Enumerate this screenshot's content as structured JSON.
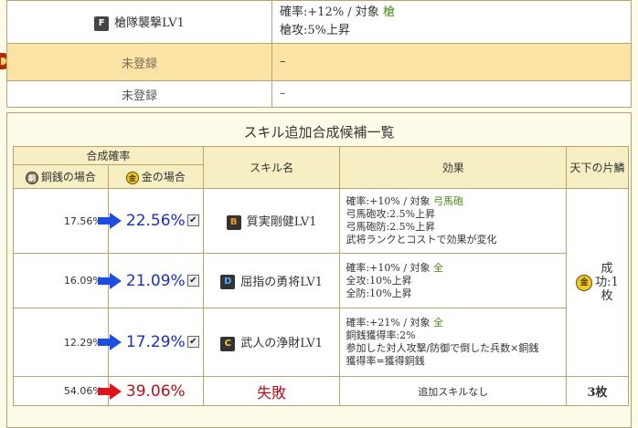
{
  "top_skills": [
    {
      "grade": "F",
      "name": "槍隊襲撃LV1",
      "effect_line1": "確率:+12% / 対象",
      "target": "槍",
      "effect_line2": "槍攻:5%上昇"
    },
    {
      "name": "未登録",
      "effect": "–"
    },
    {
      "name": "未登録",
      "effect": "–"
    }
  ],
  "section": {
    "title": "スキル追加合成候補一覧",
    "headers": {
      "rate": "合成確率",
      "copper": "銅銭の場合",
      "gold": "金の場合",
      "skill": "スキル名",
      "effect": "効果",
      "tenka": "天下の片鱗"
    },
    "coins": {
      "copper": "銅",
      "gold": "金"
    },
    "rows": [
      {
        "copper": "17.56%",
        "gold": "22.56%",
        "checked": "✔",
        "grade": "B",
        "skill": "質実剛健LV1",
        "eff": [
          "確率:+10% / 対象 ",
          "弓馬砲攻:2.5%上昇",
          "弓馬砲防:2.5%上昇",
          "武将ランクとコストで効果が変化"
        ],
        "target": "弓馬砲"
      },
      {
        "copper": "16.09%",
        "gold": "21.09%",
        "checked": "✔",
        "grade": "D",
        "skill": "屈指の勇将LV1",
        "eff": [
          "確率:+10% / 対象 ",
          "全攻:10%上昇",
          "全防:10%上昇"
        ],
        "target": "全"
      },
      {
        "copper": "12.29%",
        "gold": "17.29%",
        "checked": "✔",
        "grade": "C",
        "skill": "武人の浄財LV1",
        "eff": [
          "確率:+21% / 対象 ",
          "銅銭獲得率:2%",
          "参加した対人攻撃/防御で倒した兵数×銅銭",
          "獲得率=獲得銅銭"
        ],
        "target": "全"
      }
    ],
    "tenka_success": {
      "line1": "成",
      "line2": "功:1",
      "line3": "枚"
    },
    "fail_row": {
      "copper": "54.06%",
      "gold": "39.06%",
      "skill": "失敗",
      "effect": "追加スキルなし",
      "count": "3枚"
    }
  }
}
